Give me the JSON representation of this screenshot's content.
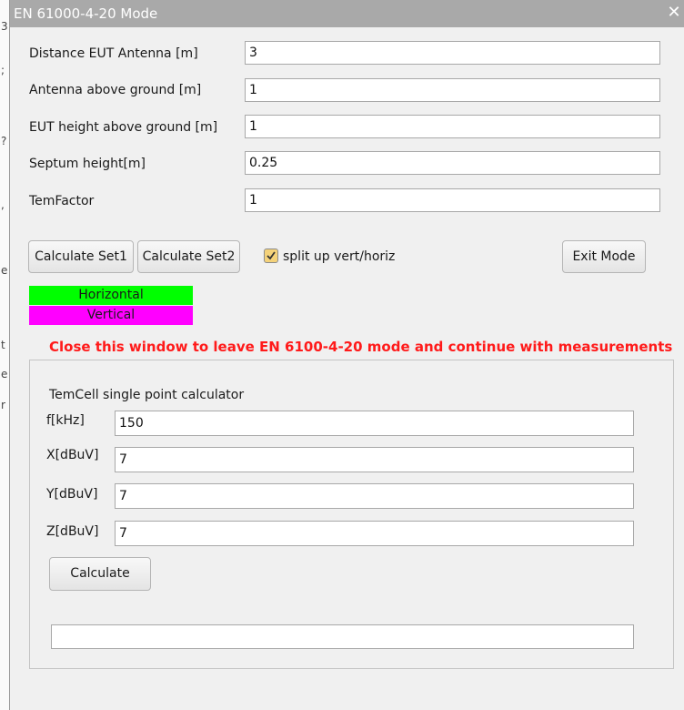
{
  "window": {
    "title": "EN 61000-4-20 Mode",
    "close_symbol": "✕"
  },
  "background_glyphs": [
    "3",
    ";",
    "?",
    ",",
    "e",
    "t",
    "e",
    "r"
  ],
  "settings": {
    "distance_label": "Distance EUT Antenna [m]",
    "distance_value": "3",
    "antenna_height_label": "Antenna above ground [m]",
    "antenna_height_value": "1",
    "eut_height_label": "EUT height above ground [m]",
    "eut_height_value": "1",
    "septum_label": "Septum height[m]",
    "septum_value": "0.25",
    "temfactor_label": "TemFactor",
    "temfactor_value": "1"
  },
  "buttons": {
    "calc_set1": "Calculate Set1",
    "calc_set2": "Calculate Set2",
    "exit_mode": "Exit Mode"
  },
  "split_checkbox": {
    "label": "split up vert/horiz",
    "checked": true
  },
  "legend": {
    "horizontal_label": "Horizontal",
    "horizontal_color": "#00ff00",
    "vertical_label": "Vertical",
    "vertical_color": "#ff00ff"
  },
  "warning": {
    "text": "Close this window to leave EN 6100-4-20  mode and continue with measurements",
    "color": "#ff1a1a"
  },
  "calculator": {
    "title": "TemCell single point calculator",
    "f_label": "f[kHz]",
    "f_value": "150",
    "x_label": "X[dBuV]",
    "x_value": "7",
    "y_label": "Y[dBuV]",
    "y_value": "7",
    "z_label": "Z[dBuV]",
    "z_value": "7",
    "calculate_label": "Calculate",
    "result_value": ""
  }
}
